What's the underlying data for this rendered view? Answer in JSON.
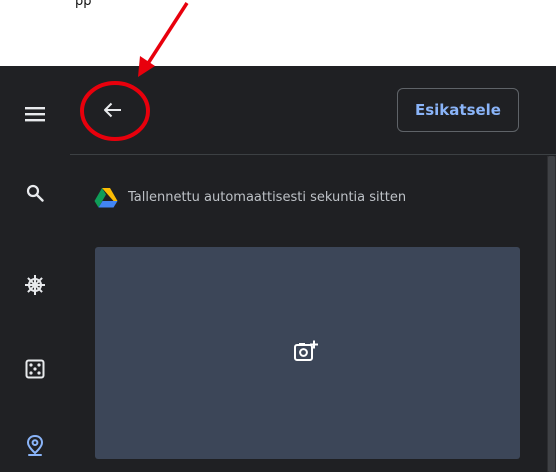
{
  "page": {
    "annotation_top_label": "pp"
  },
  "sidebar": {
    "items": [
      {
        "name": "menu",
        "icon": "hamburger-menu-icon"
      },
      {
        "name": "search",
        "icon": "search-icon"
      },
      {
        "name": "theme",
        "icon": "ship-wheel-icon"
      },
      {
        "name": "dice",
        "icon": "dice-icon"
      },
      {
        "name": "location",
        "icon": "location-pin-icon"
      }
    ]
  },
  "header": {
    "back_icon": "arrow-left-icon",
    "preview_label": "Esikatsele"
  },
  "content": {
    "autosave_text": "Tallennettu automaattisesti sekuntia sitten",
    "drive_icon": "google-drive-icon",
    "add_image_icon": "add-photo-icon"
  },
  "colors": {
    "sidebar_bg": "#202124",
    "main_bg": "#1f2023",
    "accent_blue": "#8ab4f8",
    "image_placeholder": "#3c4658",
    "annotation_red": "#e8000c"
  }
}
